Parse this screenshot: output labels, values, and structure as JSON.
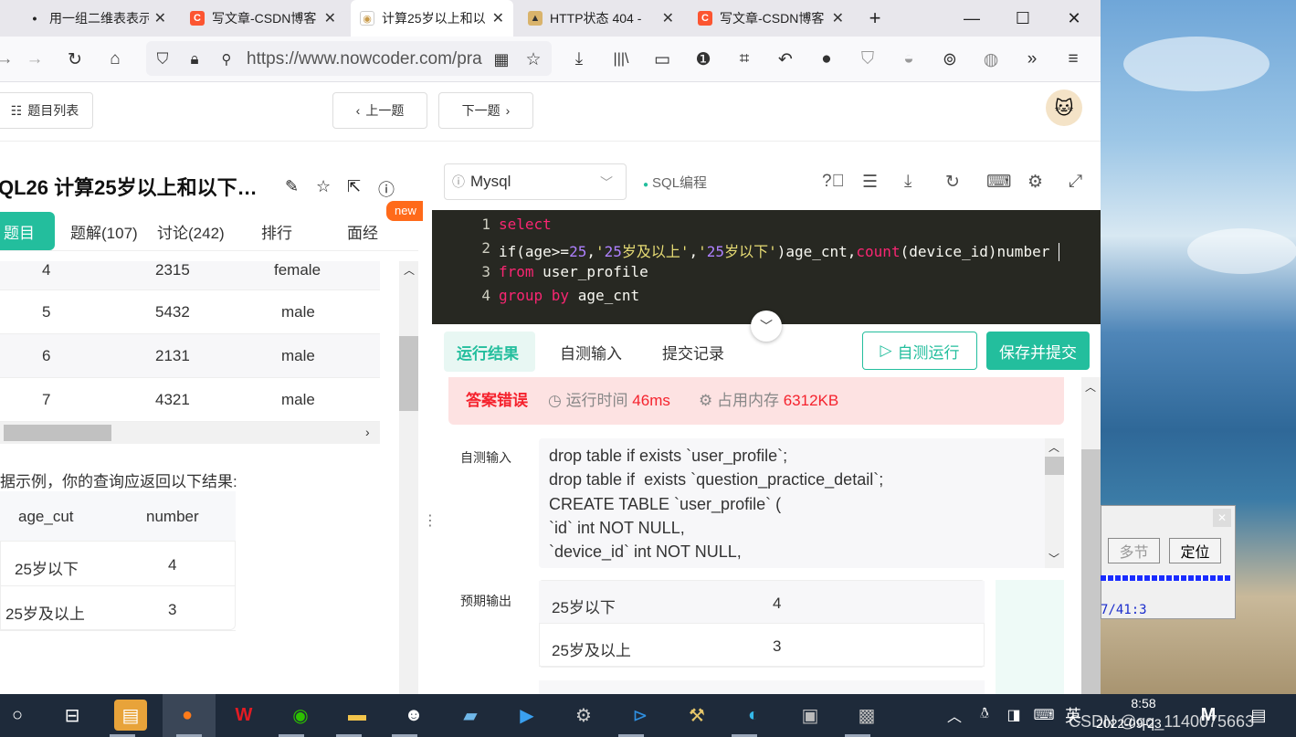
{
  "tabs": [
    {
      "title": "用一组二维表表示",
      "icon": "dot-icon"
    },
    {
      "title": "写文章-CSDN博客",
      "icon": "csdn-icon"
    },
    {
      "title": "计算25岁以上和以",
      "icon": "nowcoder-icon"
    },
    {
      "title": "HTTP状态 404 -",
      "icon": "tomcat-icon"
    },
    {
      "title": "写文章-CSDN博客",
      "icon": "csdn-icon"
    }
  ],
  "url": "https://www.nowcoder.com/pra",
  "header": {
    "list_label": "题目列表",
    "prev_label": "上一题",
    "next_label": "下一题"
  },
  "problem": {
    "title": "QL26  计算25岁以上和以下…",
    "new_badge": "new"
  },
  "left_tabs": [
    "题目",
    "题解(107)",
    "讨论(242)",
    "排行",
    "面经"
  ],
  "sample_rows": [
    {
      "id": "4",
      "device": "2315",
      "gender": "female"
    },
    {
      "id": "5",
      "device": "5432",
      "gender": "male"
    },
    {
      "id": "6",
      "device": "2131",
      "gender": "male"
    },
    {
      "id": "7",
      "device": "4321",
      "gender": "male"
    }
  ],
  "instruction": "据示例，你的查询应返回以下结果:",
  "expected": {
    "headers": [
      "age_cut",
      "number"
    ],
    "rows": [
      [
        "25岁以下",
        "4"
      ],
      [
        "25岁及以上",
        "3"
      ]
    ]
  },
  "editor": {
    "language": "Mysql",
    "mode": "SQL编程",
    "lines": [
      "select",
      "if(age>=25,'25岁及以上','25岁以下')age_cnt,count(device_id)number",
      "from user_profile",
      "group by age_cnt"
    ]
  },
  "result_tabs": [
    "运行结果",
    "自测输入",
    "提交记录"
  ],
  "run_label": "自测运行",
  "submit_label": "保存并提交",
  "result": {
    "status": "答案错误",
    "time_label": "运行时间",
    "time": "46ms",
    "mem_label": "占用内存",
    "mem": "6312KB"
  },
  "input_label": "自测输入",
  "input_lines": [
    "drop table if exists `user_profile`;",
    "drop table if  exists `question_practice_detail`;",
    "CREATE TABLE `user_profile` (",
    "`id` int NOT NULL,",
    "`device_id` int NOT NULL,"
  ],
  "output_label": "预期输出",
  "output_rows": [
    [
      "25岁以下",
      "4"
    ],
    [
      "25岁及以上",
      "3"
    ]
  ],
  "popup": {
    "btn1": "多节",
    "btn2": "定位",
    "text": "7/41:3"
  },
  "tray": {
    "time": "8:58",
    "date": "2022-09-23",
    "ime": "英",
    "watermark": "CSDN @qq_1140075663"
  }
}
